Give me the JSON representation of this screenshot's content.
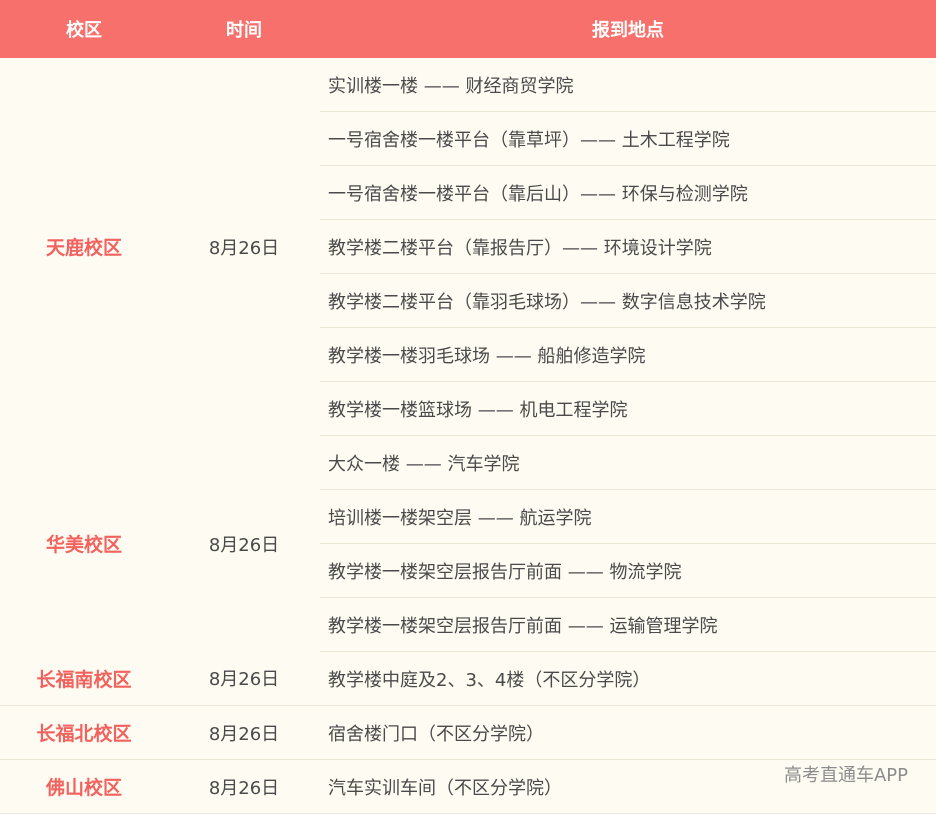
{
  "headers": {
    "campus": "校区",
    "time": "时间",
    "location": "报到地点"
  },
  "groups": [
    {
      "campus": "天鹿校区",
      "date": "8月26日",
      "locations": [
        "实训楼一楼 —— 财经商贸学院",
        "一号宿舍楼一楼平台（靠草坪）—— 土木工程学院",
        "一号宿舍楼一楼平台（靠后山）—— 环保与检测学院",
        "教学楼二楼平台（靠报告厅）—— 环境设计学院",
        "教学楼二楼平台（靠羽毛球场）—— 数字信息技术学院",
        "教学楼一楼羽毛球场 —— 船舶修造学院",
        "教学楼一楼篮球场 —— 机电工程学院"
      ]
    },
    {
      "campus": "华美校区",
      "date": "8月26日",
      "locations": [
        "大众一楼 —— 汽车学院",
        "培训楼一楼架空层 —— 航运学院",
        "教学楼一楼架空层报告厅前面 —— 物流学院",
        "教学楼一楼架空层报告厅前面 —— 运输管理学院"
      ]
    },
    {
      "campus": "长福南校区",
      "date": "8月26日",
      "locations": [
        "教学楼中庭及2、3、4楼（不区分学院）"
      ]
    },
    {
      "campus": "长福北校区",
      "date": "8月26日",
      "locations": [
        "宿舍楼门口（不区分学院）"
      ]
    },
    {
      "campus": "佛山校区",
      "date": "8月26日",
      "locations": [
        "汽车实训车间（不区分学院）"
      ]
    }
  ],
  "watermark": "高考直通车APP"
}
